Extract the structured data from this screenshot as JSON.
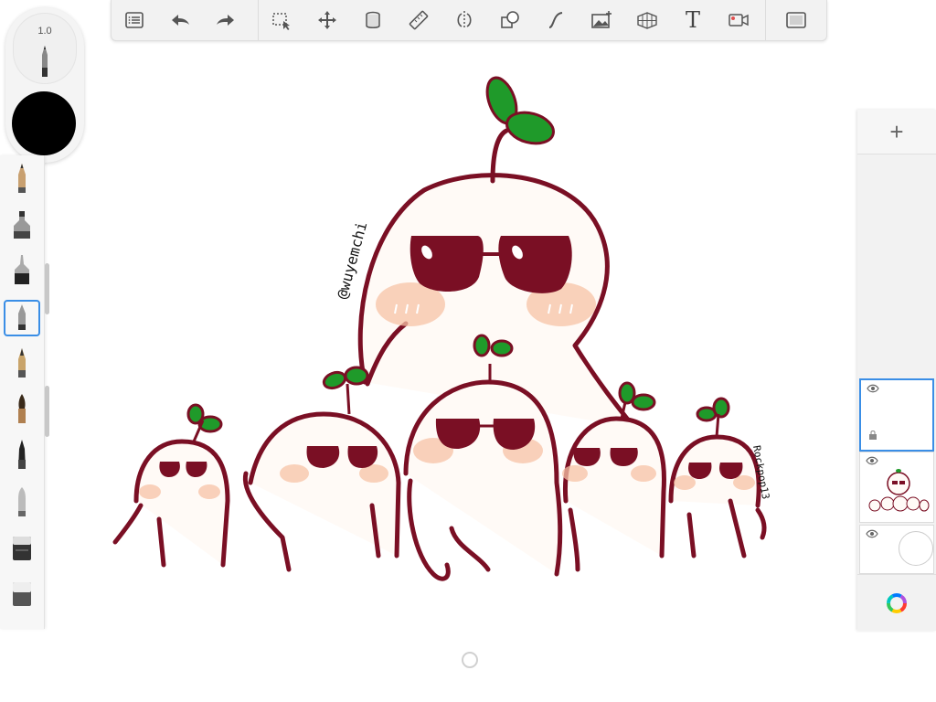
{
  "toolbar": {
    "items": [
      {
        "name": "menu-list-icon"
      },
      {
        "name": "undo-icon"
      },
      {
        "name": "redo-icon"
      },
      {
        "name": "selection-icon"
      },
      {
        "name": "transform-icon"
      },
      {
        "name": "fill-bucket-icon"
      },
      {
        "name": "ruler-icon"
      },
      {
        "name": "symmetry-icon"
      },
      {
        "name": "shapes-icon"
      },
      {
        "name": "stroke-curve-icon"
      },
      {
        "name": "import-image-icon"
      },
      {
        "name": "perspective-grid-icon"
      },
      {
        "name": "text-tool-icon",
        "label": "T"
      },
      {
        "name": "time-lapse-icon"
      },
      {
        "name": "fullscreen-icon"
      }
    ]
  },
  "brush_puck": {
    "size_value": "1.0",
    "current_color": "#000000"
  },
  "brush_palette": {
    "brushes": [
      "pencil",
      "marker",
      "fineliner",
      "ballpoint",
      "fountain-pen",
      "paintbrush",
      "airbrush",
      "chisel-marker",
      "eraser",
      "soft-eraser"
    ],
    "selected_index": 3
  },
  "layers": {
    "add_label": "+",
    "items": [
      {
        "name": "layer-1",
        "visible": true,
        "selected": true
      },
      {
        "name": "layer-2",
        "visible": true,
        "selected": false
      },
      {
        "name": "background-layer",
        "visible": true,
        "selected": false
      }
    ]
  },
  "canvas": {
    "artwork": "sprout characters with sunglasses",
    "signature_text_1": "@wuyemchi",
    "signature_text_2": "Rockpop13"
  },
  "colors": {
    "outline": "#7a0f24",
    "leaf": "#1f9a2a",
    "blush": "#f7c3a6",
    "accent": "#3a8ee6"
  }
}
